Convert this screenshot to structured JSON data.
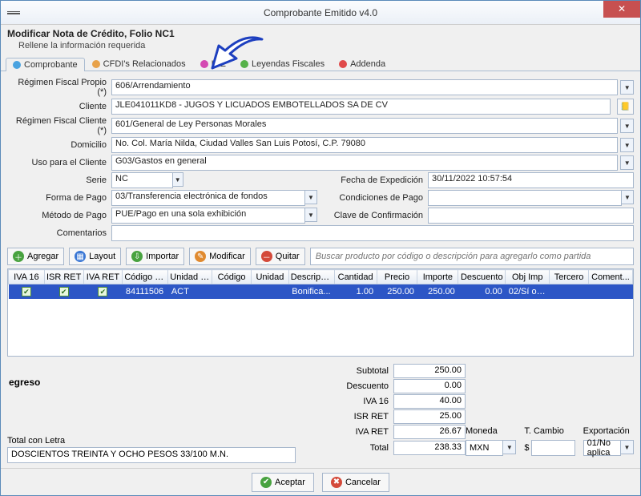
{
  "window": {
    "title": "Comprobante Emitido v4.0"
  },
  "subheader": {
    "heading": "Modificar Nota de Crédito, Folio NC1",
    "instruction": "Rellene la información requerida"
  },
  "tabs": [
    {
      "label": "Comprobante",
      "color": "#4aa3e0",
      "active": true
    },
    {
      "label": "CFDI's Relacionados",
      "color": "#e8a24a",
      "active": false
    },
    {
      "label": "INE",
      "color": "#d44ab2",
      "active": false
    },
    {
      "label": "Leyendas Fiscales",
      "color": "#57b24a",
      "active": false
    },
    {
      "label": "Addenda",
      "color": "#e04a4a",
      "active": false
    }
  ],
  "form": {
    "regimen_propio_label": "Régimen Fiscal Propio (*)",
    "regimen_propio": "606/Arrendamiento",
    "cliente_label": "Cliente",
    "cliente": "JLE041011KD8 - JUGOS Y LICUADOS EMBOTELLADOS SA DE CV",
    "regimen_cliente_label": "Régimen Fiscal Cliente (*)",
    "regimen_cliente": "601/General de Ley Personas Morales",
    "domicilio_label": "Domicilio",
    "domicilio": "No.  Col. María Nilda, Ciudad Valles San Luis Potosí, C.P. 79080",
    "uso_label": "Uso para el Cliente",
    "uso": "G03/Gastos en general",
    "serie_label": "Serie",
    "serie": "NC",
    "fecha_label": "Fecha de Expedición",
    "fecha": "30/11/2022 10:57:54",
    "forma_pago_label": "Forma de Pago",
    "forma_pago": "03/Transferencia electrónica de fondos",
    "condiciones_label": "Condiciones de Pago",
    "condiciones": "",
    "metodo_pago_label": "Método de Pago",
    "metodo_pago": "PUE/Pago en una sola exhibición",
    "clave_conf_label": "Clave de Confirmación",
    "clave_conf": "",
    "comentarios_label": "Comentarios",
    "comentarios": ""
  },
  "toolbar": {
    "agregar": "Agregar",
    "layout": "Layout",
    "importar": "Importar",
    "modificar": "Modificar",
    "quitar": "Quitar",
    "search_placeholder": "Buscar producto por código o descripción para agregarlo como partida"
  },
  "grid": {
    "columns": [
      "IVA 16",
      "ISR RET",
      "IVA RET",
      "Código S...",
      "Unidad S...",
      "Código",
      "Unidad",
      "Descripci...",
      "Cantidad",
      "Precio",
      "Importe",
      "Descuento",
      "Obj Imp",
      "Tercero",
      "Coment..."
    ],
    "rows": [
      {
        "iva16": true,
        "isrret": true,
        "ivaret": true,
        "codigo_sat": "84111506",
        "unidad_sat": "ACT",
        "codigo": "",
        "unidad": "",
        "descripcion": "Bonifica...",
        "cantidad": "1.00",
        "precio": "250.00",
        "importe": "250.00",
        "descuento": "0.00",
        "obj_imp": "02/Sí obj...",
        "tercero": "",
        "coment": ""
      }
    ]
  },
  "footer": {
    "egreso": "egreso",
    "totals": {
      "subtotal_label": "Subtotal",
      "subtotal": "250.00",
      "descuento_label": "Descuento",
      "descuento": "0.00",
      "iva16_label": "IVA 16",
      "iva16": "40.00",
      "isrret_label": "ISR RET",
      "isrret": "25.00",
      "ivaret_label": "IVA RET",
      "ivaret": "26.67",
      "total_label": "Total",
      "total": "238.33"
    },
    "letra_label": "Total con Letra",
    "letra": "DOSCIENTOS TREINTA Y OCHO PESOS 33/100 M.N.",
    "moneda_label": "Moneda",
    "moneda": "MXN",
    "tcambio_label": "T. Cambio",
    "tcambio_prefix": "$",
    "tcambio": "",
    "export_label": "Exportación",
    "export": "01/No aplica"
  },
  "actions": {
    "aceptar": "Aceptar",
    "cancelar": "Cancelar"
  }
}
